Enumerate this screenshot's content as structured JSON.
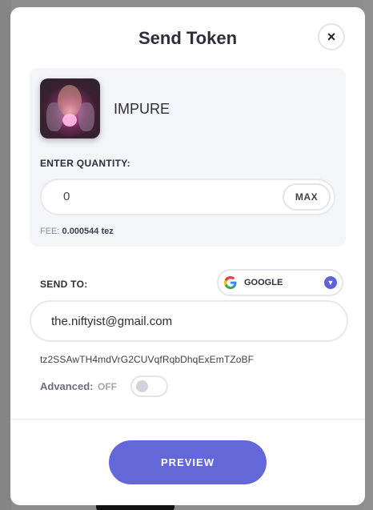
{
  "modal": {
    "title": "Send Token",
    "close_icon": "×"
  },
  "token": {
    "name": "IMPURE"
  },
  "quantity": {
    "label": "ENTER QUANTITY:",
    "value": "0",
    "max_label": "MAX"
  },
  "fee": {
    "label": "FEE:",
    "value": "0.000544 tez"
  },
  "send_to": {
    "label": "SEND TO:",
    "provider": "GOOGLE",
    "email": "the.niftyist@gmail.com",
    "address": "tz2SSAwTH4mdVrG2CUVqfRqbDhqExEmTZoBF"
  },
  "advanced": {
    "label": "Advanced:",
    "state": "OFF"
  },
  "actions": {
    "preview_label": "PREVIEW"
  },
  "colors": {
    "accent": "#6467d8",
    "text": "#2b2f3a",
    "card_bg": "#f4f5f8"
  },
  "icons": {
    "close": "close-icon",
    "provider": "google-icon",
    "dropdown": "chevron-down-icon"
  }
}
